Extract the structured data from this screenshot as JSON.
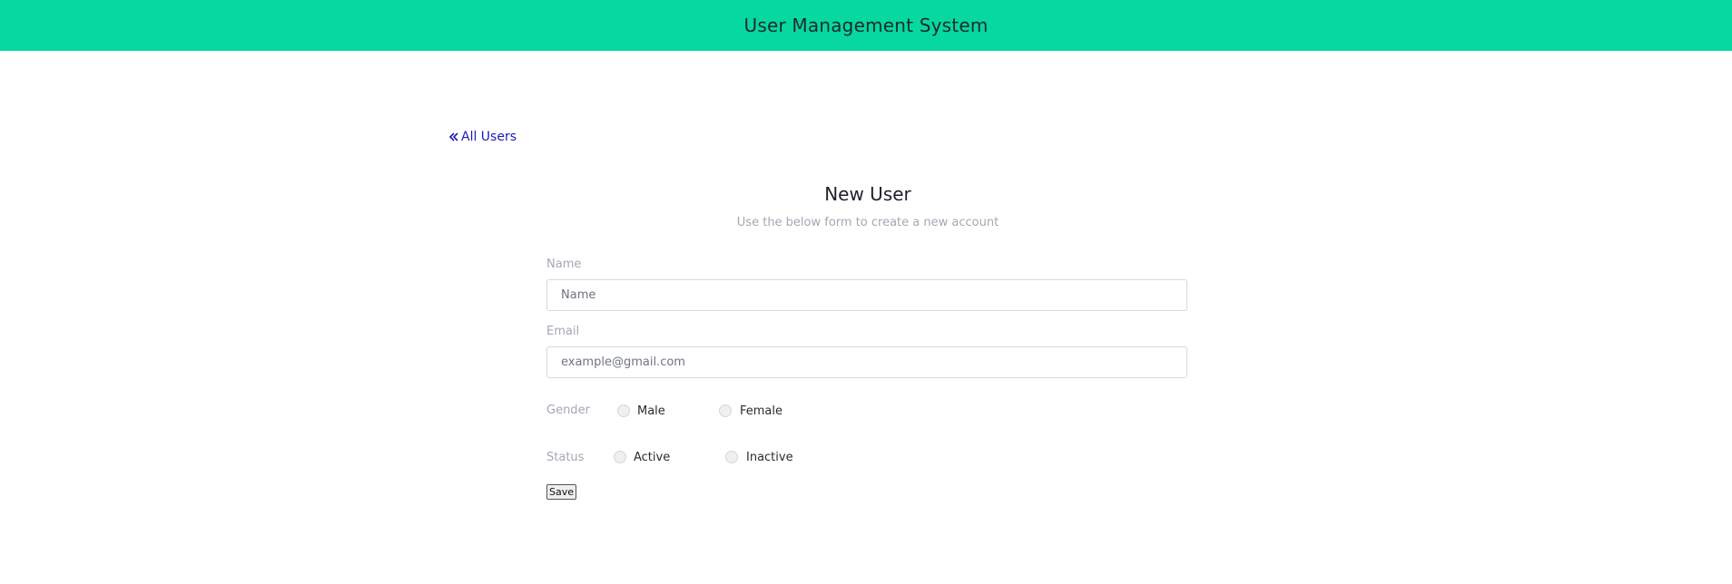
{
  "header": {
    "title": "User Management System"
  },
  "nav": {
    "back_label": "All Users"
  },
  "form": {
    "title": "New User",
    "subtitle": "Use the below form to create a new account",
    "name": {
      "label": "Name",
      "placeholder": "Name",
      "value": ""
    },
    "email": {
      "label": "Email",
      "placeholder": "example@gmail.com",
      "value": ""
    },
    "gender": {
      "label": "Gender",
      "options": [
        "Male",
        "Female"
      ]
    },
    "status": {
      "label": "Status",
      "options": [
        "Active",
        "Inactive"
      ]
    },
    "save_label": "Save"
  },
  "colors": {
    "header_bg": "#06d89f",
    "link": "#1d1ab9",
    "muted_text": "#a3a8b3"
  },
  "icons": {
    "back": "double-chevron-left-icon"
  }
}
